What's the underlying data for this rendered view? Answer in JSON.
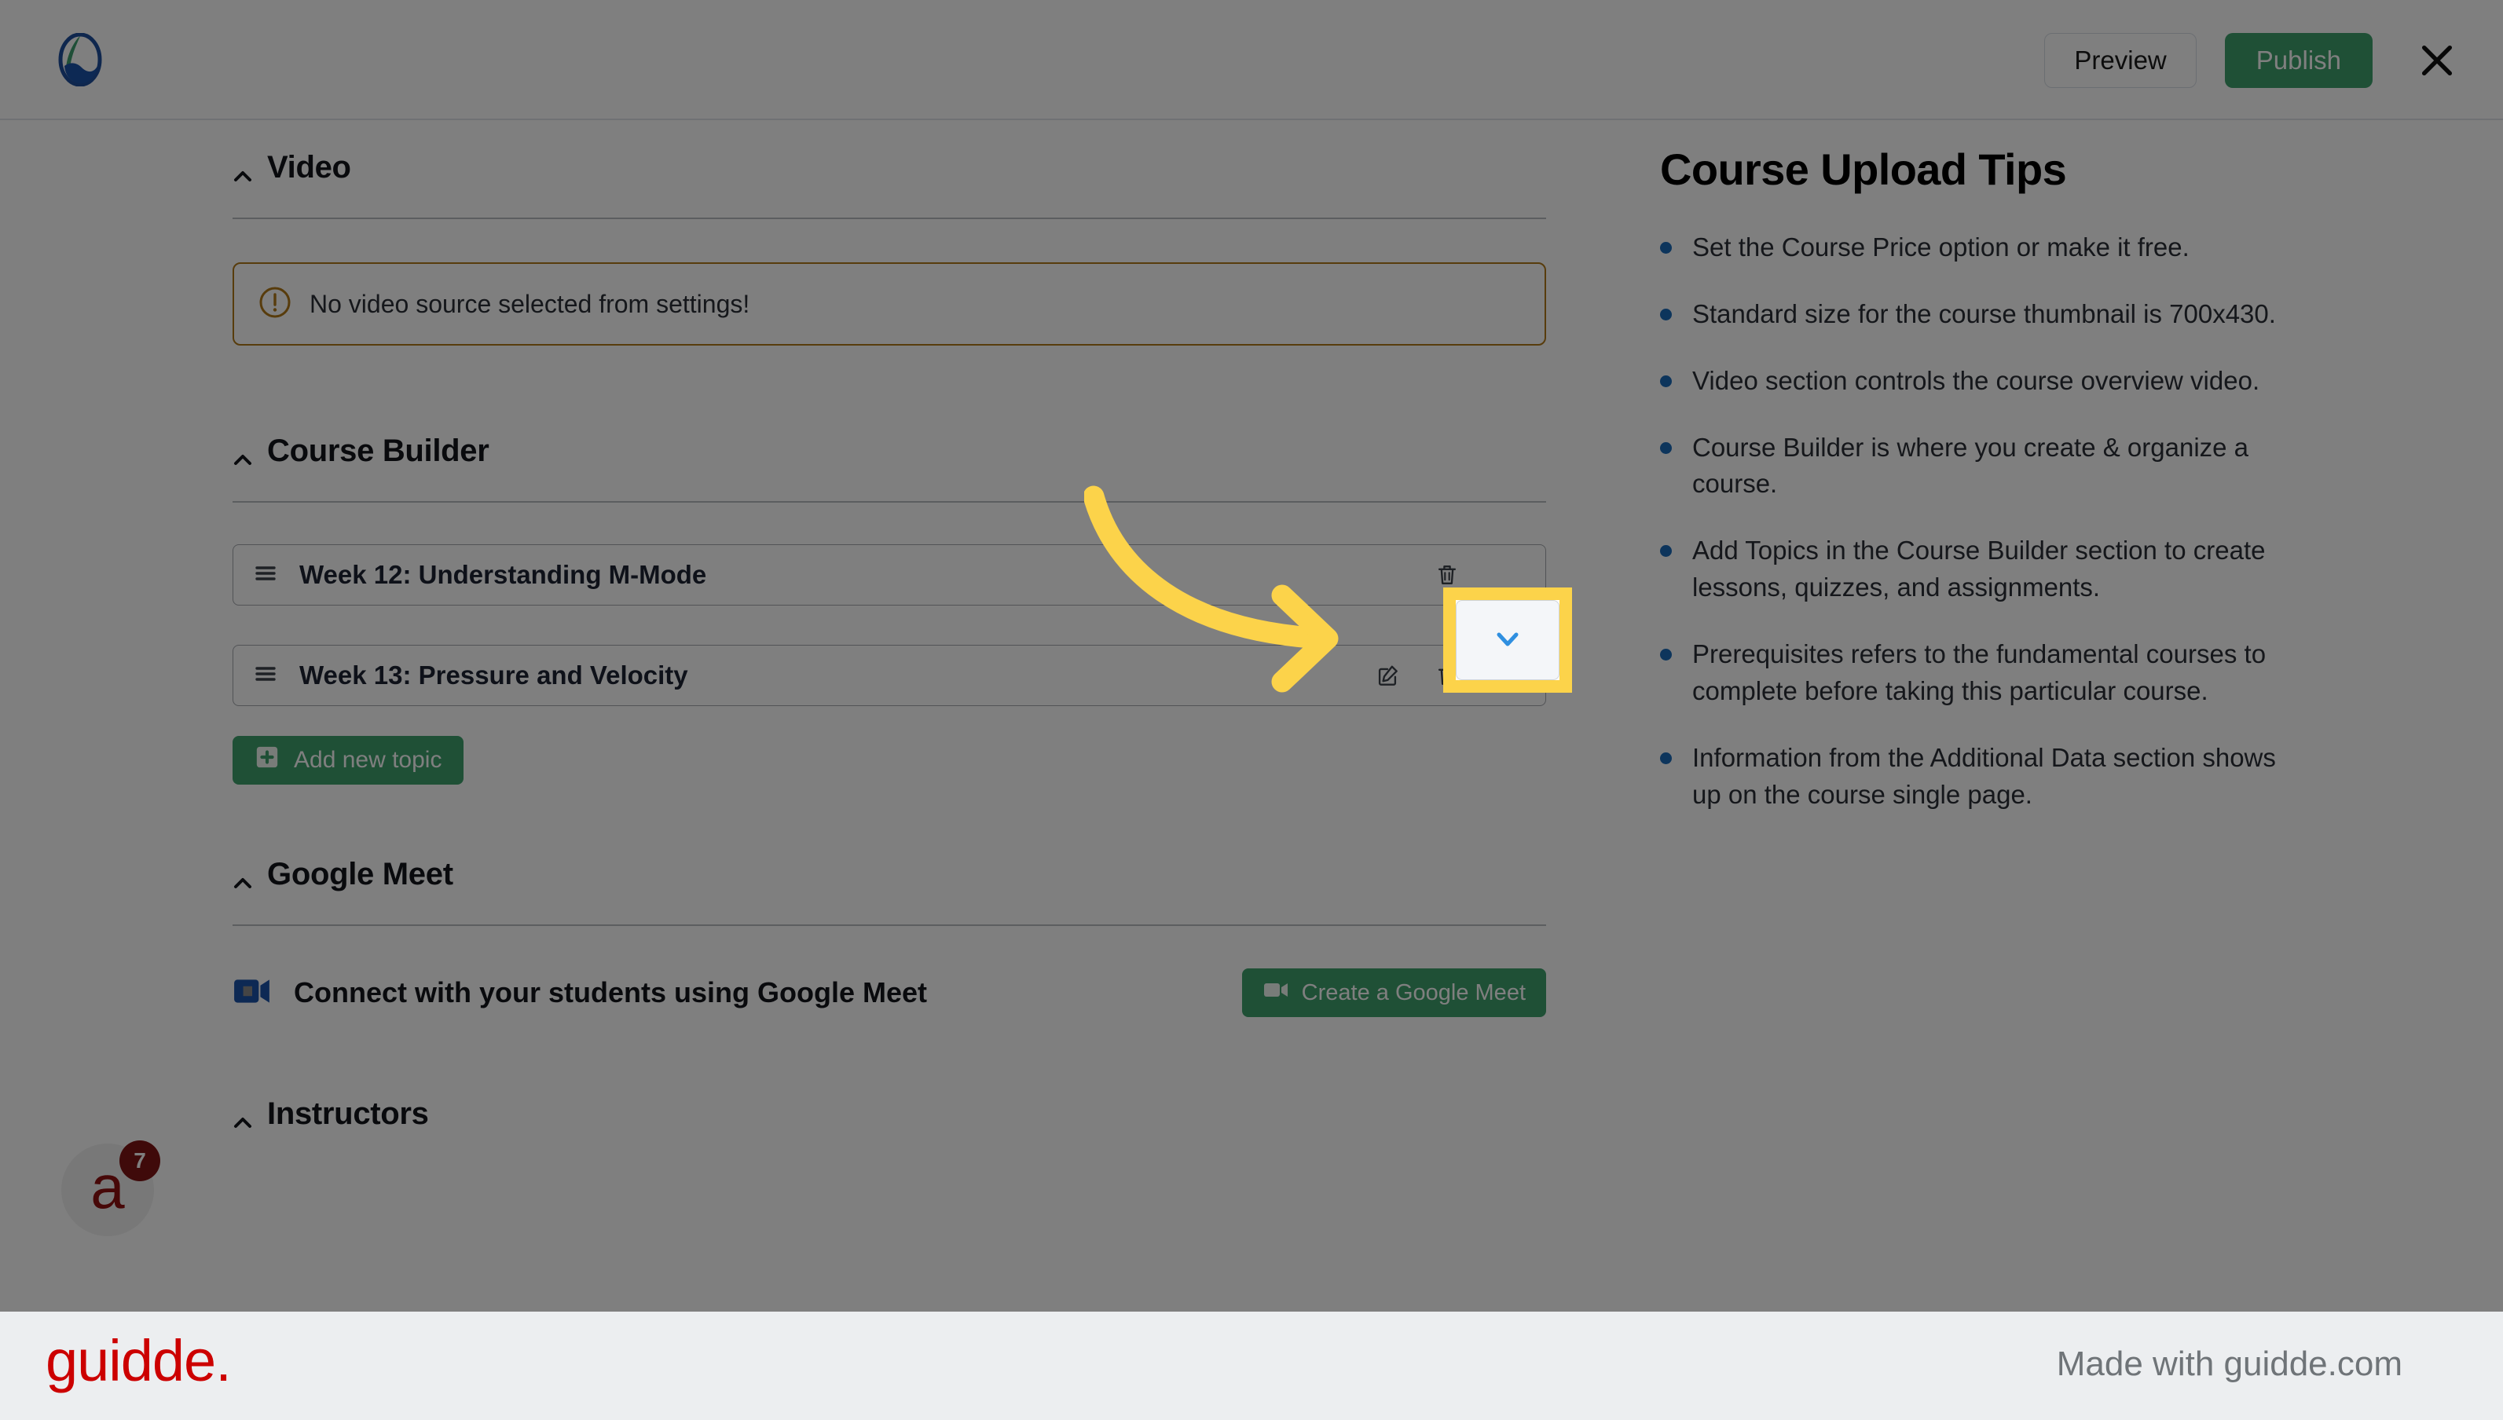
{
  "topbar": {
    "logo_icon": "tutor-lms-logo-icon",
    "preview_label": "Preview",
    "publish_label": "Publish",
    "close_icon": "close-icon",
    "accent_green": "#3fa06c"
  },
  "video_section": {
    "title": "Video",
    "collapse_icon": "chevron-up-icon",
    "warning_icon": "alert-circle-icon",
    "warning_text": "No video source selected from settings!",
    "warning_color": "#b07818"
  },
  "course_builder": {
    "title": "Course Builder",
    "collapse_icon": "chevron-up-icon",
    "topics": [
      {
        "drag_icon": "drag-handle-icon",
        "title": "Week 12: Understanding M-Mode",
        "actions": [
          "trash-icon",
          "chevron-down-icon"
        ]
      },
      {
        "drag_icon": "drag-handle-icon",
        "title": "Week 13: Pressure and Velocity",
        "actions": [
          "edit-icon",
          "trash-icon",
          "chevron-down-icon"
        ]
      }
    ],
    "add_topic_label": "Add new topic",
    "add_topic_icon": "plus-square-icon"
  },
  "google_meet": {
    "title": "Google Meet",
    "collapse_icon": "chevron-up-icon",
    "meet_icon": "google-meet-video-icon",
    "description": "Connect with your students using Google Meet",
    "create_button_label": "Create a Google Meet",
    "create_button_icon": "video-camera-icon"
  },
  "instructors_section": {
    "title": "Instructors",
    "collapse_icon": "chevron-up-icon"
  },
  "tips": {
    "title": "Course Upload Tips",
    "bullet_color": "#1a6bb8",
    "items": [
      "Set the Course Price option or make it free.",
      "Standard size for the course thumbnail is 700x430.",
      "Video section controls the course overview video.",
      "Course Builder is where you create & organize a course.",
      "Add Topics in the Course Builder section to create lessons, quizzes, and assignments.",
      "Prerequisites refers to the fundamental courses to complete before taking this particular course.",
      "Information from the Additional Data section shows up on the course single page."
    ]
  },
  "chat_widget": {
    "glyph": "a",
    "badge_count": "7"
  },
  "highlight": {
    "target_icon": "chevron-down-icon",
    "border_color": "#fcd34a",
    "arrow_icon": "curved-arrow-icon",
    "arrow_color": "#fcd34a"
  },
  "footer": {
    "logo_text": "guidde.",
    "made_with": "Made with guidde.com",
    "logo_color": "#cc0000"
  }
}
